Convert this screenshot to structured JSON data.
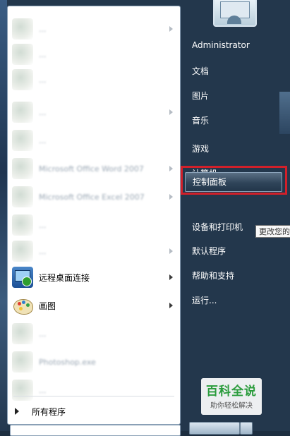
{
  "start_menu": {
    "programs": [
      {
        "label": "...",
        "blurred": true,
        "has_submenu": true
      },
      {
        "label": "...",
        "blurred": true,
        "has_submenu": false
      },
      {
        "label": "...",
        "blurred": true,
        "has_submenu": false
      },
      {
        "label": "...",
        "blurred": true,
        "has_submenu": true
      },
      {
        "label": "...",
        "blurred": true,
        "has_submenu": false
      },
      {
        "label": "Microsoft Office Word 2007",
        "blurred": true,
        "has_submenu": true
      },
      {
        "label": "Microsoft Office Excel 2007",
        "blurred": true,
        "has_submenu": true
      },
      {
        "label": "...",
        "blurred": true,
        "has_submenu": false
      },
      {
        "label": "...",
        "blurred": true,
        "has_submenu": true
      },
      {
        "label": "远程桌面连接",
        "blurred": false,
        "has_submenu": true
      },
      {
        "label": "画图",
        "blurred": false,
        "has_submenu": true
      },
      {
        "label": "...",
        "blurred": true,
        "has_submenu": false
      },
      {
        "label": "Photoshop.exe",
        "blurred": true,
        "has_submenu": false
      },
      {
        "label": "...",
        "blurred": true,
        "has_submenu": false
      }
    ],
    "all_programs_label": "所有程序",
    "right_pane": {
      "user_name": "Administrator",
      "items": [
        {
          "label": "文档"
        },
        {
          "label": "图片"
        },
        {
          "label": "音乐"
        },
        {
          "label": "游戏"
        },
        {
          "label": "计算机"
        },
        {
          "label": "控制面板"
        },
        {
          "label": "设备和打印机"
        },
        {
          "label": "默认程序"
        },
        {
          "label": "帮助和支持"
        },
        {
          "label": "运行..."
        }
      ],
      "highlighted_item": "控制面板",
      "tooltip": "更改您的"
    }
  },
  "watermark": {
    "title": "百科全说",
    "subtitle": "助你轻松解决"
  },
  "colors": {
    "highlight_border": "#d1202a",
    "menu_background": "#23374c",
    "watermark_green": "#2a9c3c"
  }
}
